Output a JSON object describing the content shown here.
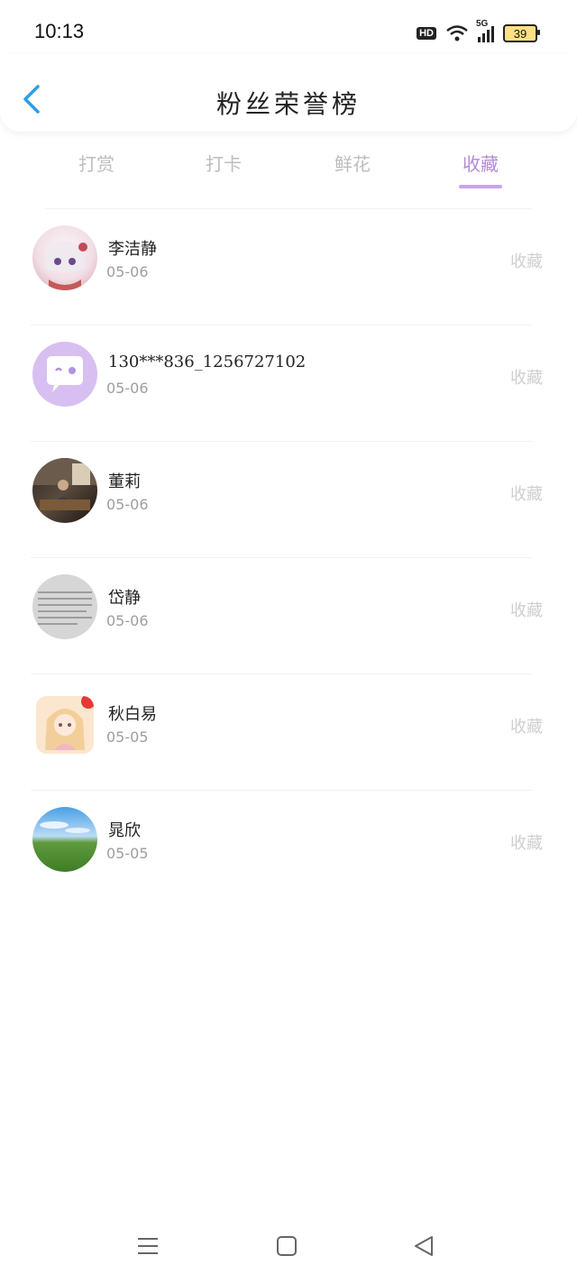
{
  "status_bar": {
    "time": "10:13",
    "hd_label": "HD",
    "network_label": "5G",
    "battery": "39"
  },
  "header": {
    "title": "粉丝荣誉榜"
  },
  "tabs": [
    {
      "label": "打赏",
      "active": false
    },
    {
      "label": "打卡",
      "active": false
    },
    {
      "label": "鲜花",
      "active": false
    },
    {
      "label": "收藏",
      "active": true
    }
  ],
  "colors": {
    "accent": "#b28ad6",
    "back_arrow": "#2d9de6"
  },
  "entries": [
    {
      "name": "李洁静",
      "date": "05-06",
      "action": "收藏"
    },
    {
      "name": "130***836_1256727102",
      "date": "05-06",
      "action": "收藏"
    },
    {
      "name": "董莉",
      "date": "05-06",
      "action": "收藏"
    },
    {
      "name": "岱静",
      "date": "05-06",
      "action": "收藏"
    },
    {
      "name": "秋白易",
      "date": "05-05",
      "action": "收藏"
    },
    {
      "name": "晁欣",
      "date": "05-05",
      "action": "收藏"
    }
  ]
}
